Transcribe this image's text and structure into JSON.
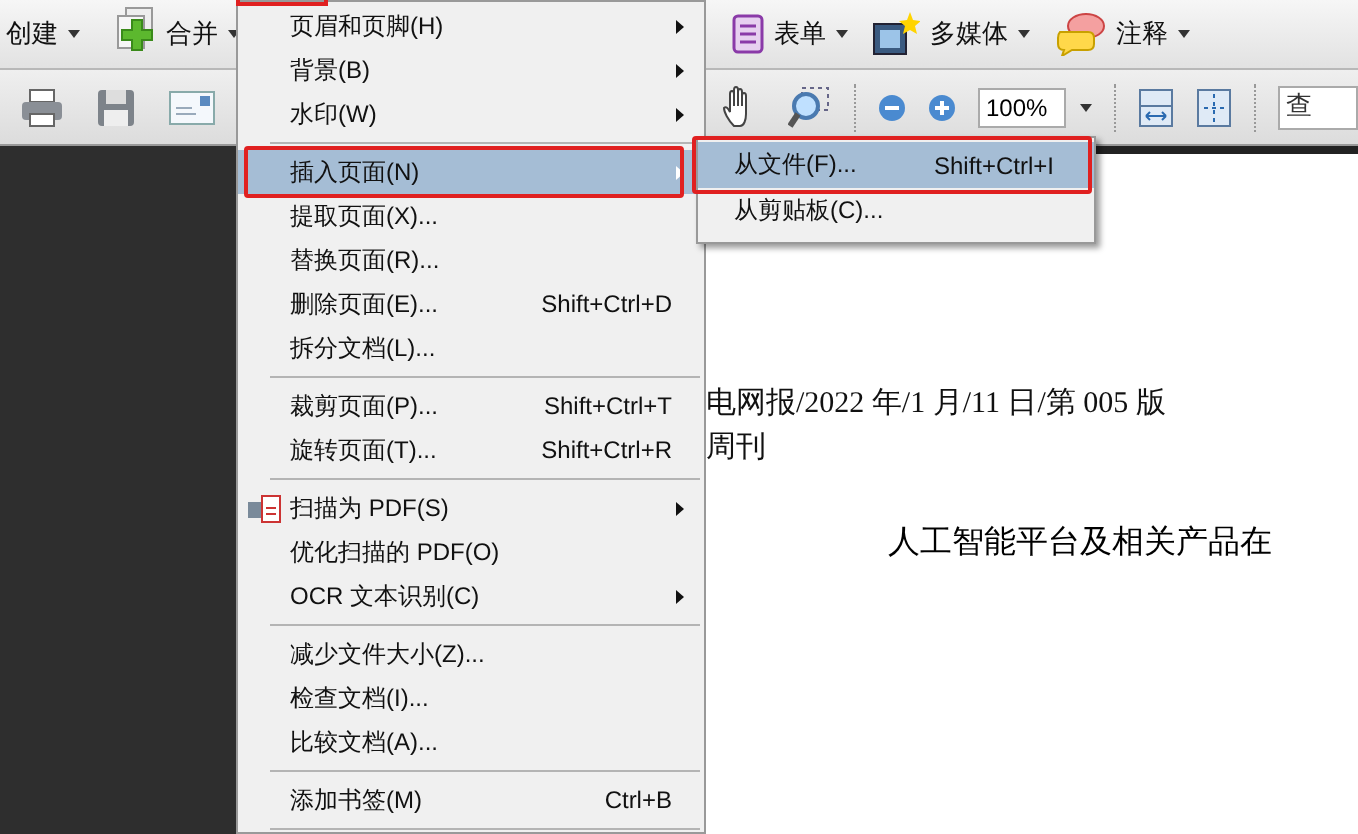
{
  "toolbar": {
    "buttons": [
      {
        "label": "创建"
      },
      {
        "label": "合并"
      },
      {
        "label": "表单"
      },
      {
        "label": "多媒体"
      },
      {
        "label": "注释"
      }
    ]
  },
  "toolbar_2": {
    "zoom_value": "100%",
    "search_placeholder": "查"
  },
  "menu": {
    "items": [
      {
        "kind": "item",
        "label": "页眉和页脚(H)",
        "submenu": true,
        "selected": false
      },
      {
        "kind": "item",
        "label": "背景(B)",
        "submenu": true,
        "selected": false
      },
      {
        "kind": "item",
        "label": "水印(W)",
        "submenu": true,
        "selected": false
      },
      {
        "kind": "separator"
      },
      {
        "kind": "item",
        "label": "插入页面(N)",
        "submenu": true,
        "selected": true
      },
      {
        "kind": "item",
        "label": "提取页面(X)...",
        "submenu": false,
        "selected": false
      },
      {
        "kind": "item",
        "label": "替换页面(R)...",
        "submenu": false,
        "selected": false
      },
      {
        "kind": "item",
        "label": "删除页面(E)...",
        "shortcut": "Shift+Ctrl+D",
        "submenu": false,
        "selected": false
      },
      {
        "kind": "item",
        "label": "拆分文档(L)...",
        "submenu": false,
        "selected": false
      },
      {
        "kind": "separator"
      },
      {
        "kind": "item",
        "label": "裁剪页面(P)...",
        "shortcut": "Shift+Ctrl+T",
        "submenu": false,
        "selected": false
      },
      {
        "kind": "item",
        "label": "旋转页面(T)...",
        "shortcut": "Shift+Ctrl+R",
        "submenu": false,
        "selected": false
      },
      {
        "kind": "separator"
      },
      {
        "kind": "iconitem",
        "label": "扫描为 PDF(S)",
        "submenu": true,
        "selected": false
      },
      {
        "kind": "item",
        "label": "优化扫描的 PDF(O)",
        "submenu": false,
        "selected": false
      },
      {
        "kind": "item",
        "label": "OCR 文本识别(C)",
        "submenu": true,
        "selected": false
      },
      {
        "kind": "separator"
      },
      {
        "kind": "item",
        "label": "减少文件大小(Z)...",
        "submenu": false,
        "selected": false
      },
      {
        "kind": "item",
        "label": "检查文档(I)...",
        "submenu": false,
        "selected": false
      },
      {
        "kind": "item",
        "label": "比较文档(A)...",
        "submenu": false,
        "selected": false
      },
      {
        "kind": "separator"
      },
      {
        "kind": "item",
        "label": "添加书签(M)",
        "shortcut": "Ctrl+B",
        "submenu": false,
        "selected": false
      },
      {
        "kind": "separator"
      }
    ]
  },
  "submenu": {
    "items": [
      {
        "label": "从文件(F)...",
        "shortcut": "Shift+Ctrl+I",
        "selected": true
      },
      {
        "label": "从剪贴板(C)...",
        "selected": false
      }
    ]
  },
  "document": {
    "lines": [
      "电网报/2022 年/1 月/11 日/第 005 版",
      "周刊"
    ],
    "title": "人工智能平台及相关产品在"
  }
}
